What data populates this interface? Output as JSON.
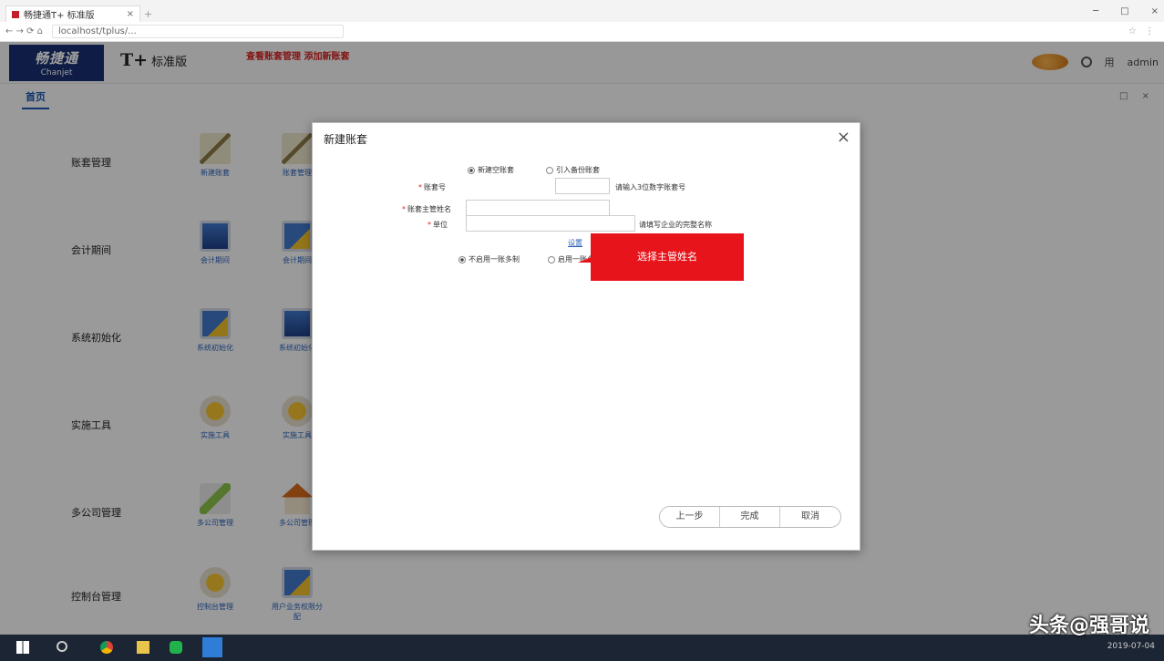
{
  "browser": {
    "tab_title": "畅捷通T+ 标准版",
    "tab_close": "×",
    "new_tab": "+",
    "window_controls": [
      "─",
      "□",
      "×"
    ],
    "nav_buttons": "← → ⟳ ⌂",
    "address": "localhost/tplus/...",
    "address_right": "☆ ⋮"
  },
  "header": {
    "logo_main": "畅捷通",
    "logo_sub": "Chanjet",
    "product_mark": "T+",
    "product_name": "标准版",
    "red_links": "查看账套管理  添加新账套",
    "user_icon": "用",
    "user_name": "admin"
  },
  "tabs": {
    "home": "首页",
    "right_controls": "□ ×"
  },
  "menu": {
    "rows": [
      {
        "category": "账套管理",
        "icons": [
          {
            "label": "新建账套",
            "kind": "pen"
          },
          {
            "label": "账套管理",
            "kind": "pen"
          }
        ]
      },
      {
        "category": "会计期间",
        "icons": [
          {
            "label": "会计期间",
            "kind": "mon"
          },
          {
            "label": "会计期间",
            "kind": "monb"
          }
        ]
      },
      {
        "category": "系统初始化",
        "icons": [
          {
            "label": "系统初始化",
            "kind": "monb"
          },
          {
            "label": "系统初始化",
            "kind": "mon"
          }
        ]
      },
      {
        "category": "实施工具",
        "icons": [
          {
            "label": "实施工具",
            "kind": "gear"
          },
          {
            "label": "实施工具",
            "kind": "gear"
          }
        ]
      },
      {
        "category": "多公司管理",
        "icons": [
          {
            "label": "多公司管理",
            "kind": "flag"
          },
          {
            "label": "多公司管理",
            "kind": "house"
          }
        ]
      },
      {
        "category": "控制台管理",
        "icons": [
          {
            "label": "控制台管理",
            "kind": "gear"
          },
          {
            "label": "用户业务权限分配",
            "kind": "monb"
          }
        ]
      }
    ]
  },
  "dialog": {
    "title": "新建账套",
    "close": "×",
    "radio_a": "新建空账套",
    "radio_b": "引入备份账套",
    "account_no_label": "账套号",
    "account_no_value": "",
    "account_no_hint": "请输入3位数字账套号",
    "name_label": "账套主管姓名",
    "name_value": "",
    "company_label": "单位",
    "company_value": "",
    "company_hint": "请填写企业的完整名称",
    "link_text": "设置",
    "radio_c": "不启用一账多制",
    "radio_d": "启用一账多制",
    "buttons": {
      "prev": "上一步",
      "next": "完成",
      "cancel": "取消"
    }
  },
  "callout": {
    "text": "选择主管姓名"
  },
  "watermark": "头条@强哥说",
  "tray_time": "2019-07-04"
}
